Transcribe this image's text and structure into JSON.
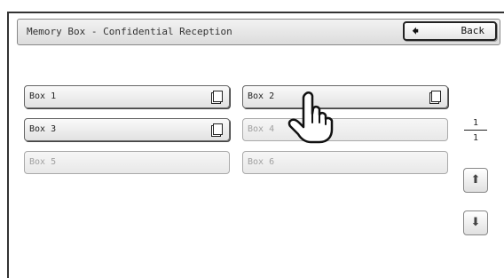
{
  "header": {
    "title": "Memory Box - Confidential Reception",
    "back_label": "Back",
    "back_icon": "left-arrow-icon"
  },
  "boxes": [
    {
      "label": "Box 1",
      "enabled": true,
      "has_document": true
    },
    {
      "label": "Box 2",
      "enabled": true,
      "has_document": true
    },
    {
      "label": "Box 3",
      "enabled": true,
      "has_document": true
    },
    {
      "label": "Box 4",
      "enabled": false,
      "has_document": false
    },
    {
      "label": "Box 5",
      "enabled": false,
      "has_document": false
    },
    {
      "label": "Box 6",
      "enabled": false,
      "has_document": false
    }
  ],
  "pager": {
    "current": "1",
    "total": "1",
    "up_icon": "up-arrow-icon",
    "down_icon": "down-arrow-icon"
  },
  "pointer": {
    "icon": "pointing-hand-icon"
  }
}
